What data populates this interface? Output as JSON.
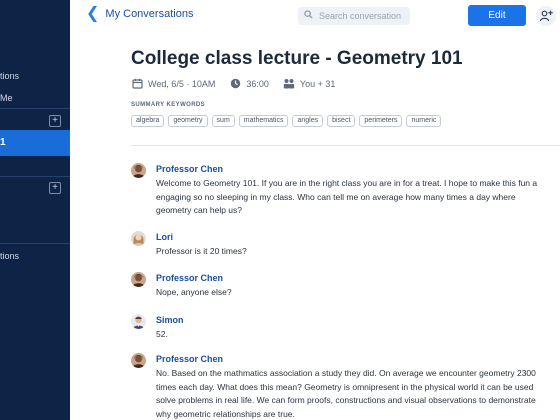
{
  "sidebar": {
    "items": [
      {
        "label": "tions"
      },
      {
        "label": "Me"
      },
      {
        "label": "1"
      },
      {
        "label": "tions"
      }
    ],
    "add_label": "+"
  },
  "topbar": {
    "back_label": "My Conversations",
    "search_placeholder": "Search conversation",
    "edit_label": "Edit",
    "add_user_label": "+"
  },
  "conversation": {
    "title": "College class lecture - Geometry 101",
    "date": "Wed, 6/5 · 10AM",
    "duration": "36:00",
    "participants": "You + 31",
    "keywords_label": "SUMMARY KEYWORDS",
    "keywords": [
      "algebra",
      "geometry",
      "sum",
      "mathematics",
      "angles",
      "bisect",
      "perimeters",
      "numeric"
    ]
  },
  "messages": [
    {
      "speaker": "Professor Chen",
      "lines": [
        "Welcome to Geometry 101. If you are in the right class you are in for a treat. I hope to make this fun a",
        "engaging so no sleeping in my class. Who can tell me on average how many times a day where",
        "geometry can help us?"
      ]
    },
    {
      "speaker": "Lori",
      "lines": [
        "Professor is it 20 times?"
      ]
    },
    {
      "speaker": "Professor Chen",
      "lines": [
        "Nope, anyone else?"
      ]
    },
    {
      "speaker": "Simon",
      "lines": [
        "52."
      ]
    },
    {
      "speaker": "Professor Chen",
      "lines": [
        "No. Based on the mathmatics association a study they did. On average we encounter geometry 2300",
        "times each day.  What does this mean? Geometry is omnipresent in the physical world it can be used",
        "solve problems in real life. We can form proofs, constructions and visual observations to demonstrate",
        "why geometric relationships are true."
      ]
    }
  ]
}
